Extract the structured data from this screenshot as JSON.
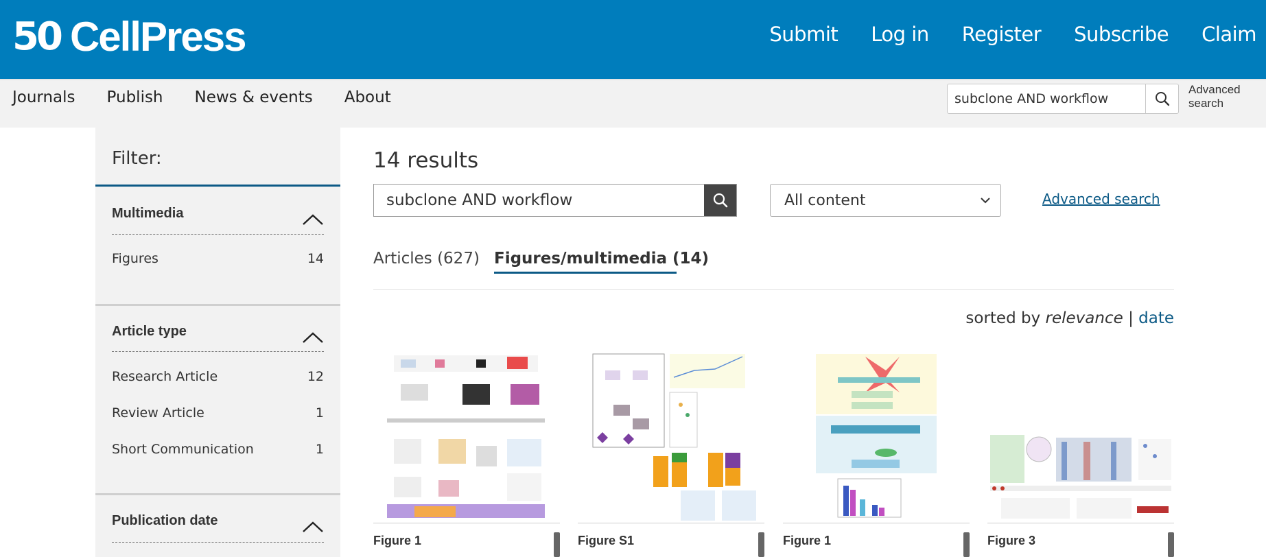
{
  "header": {
    "logo_number": "50",
    "logo_text": "CellPress",
    "nav": [
      "Submit",
      "Log in",
      "Register",
      "Subscribe",
      "Claim"
    ]
  },
  "subnav": {
    "links": [
      "Journals",
      "Publish",
      "News & events",
      "About"
    ],
    "search_value": "subclone AND workflow",
    "advanced": "Advanced search"
  },
  "sidebar": {
    "title": "Filter:",
    "sections": [
      {
        "heading": "Multimedia",
        "items": [
          {
            "label": "Figures",
            "count": "14"
          }
        ]
      },
      {
        "heading": "Article type",
        "items": [
          {
            "label": "Research Article",
            "count": "12"
          },
          {
            "label": "Review Article",
            "count": "1"
          },
          {
            "label": "Short Communication",
            "count": "1"
          }
        ]
      },
      {
        "heading": "Publication date",
        "items": []
      }
    ]
  },
  "main": {
    "results_count": "14 results",
    "search_value": "subclone AND workflow",
    "content_select": "All content",
    "advanced_link": "Advanced search",
    "tabs": [
      {
        "label": "Articles (627)",
        "active": false
      },
      {
        "label": "Figures/multimedia (14)",
        "active": true
      }
    ],
    "sort": {
      "prefix": "sorted by",
      "active": "relevance",
      "separator": "|",
      "alt": "date"
    },
    "figures": [
      {
        "label": "Figure 1"
      },
      {
        "label": "Figure S1"
      },
      {
        "label": "Figure 1"
      },
      {
        "label": "Figure 3"
      }
    ]
  },
  "colors": {
    "brand_blue": "#007dbc",
    "link_blue": "#0c5a86",
    "sidebar_bg": "#f2f2f2"
  }
}
